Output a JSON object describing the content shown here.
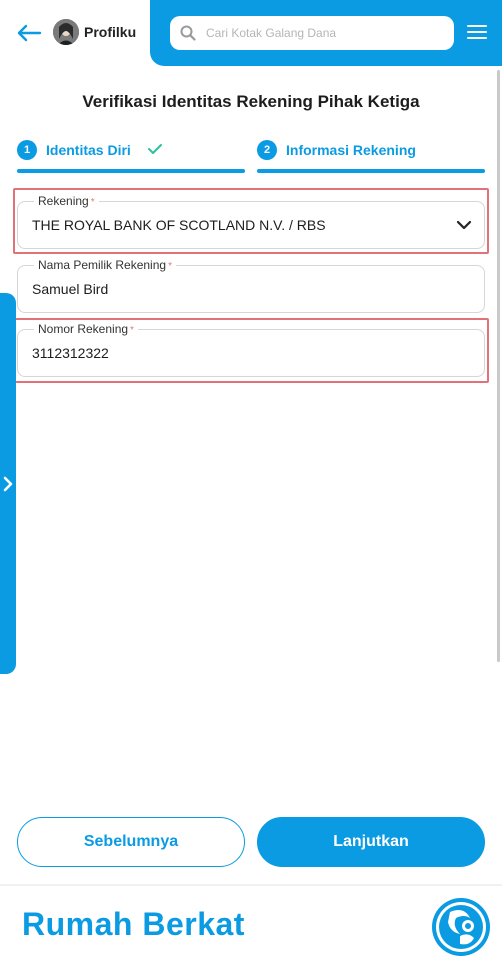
{
  "header": {
    "back_icon": "arrow-left-icon",
    "profile_label": "Profilku",
    "search_placeholder": "Cari Kotak Galang Dana",
    "menu_icon": "hamburger-menu-icon"
  },
  "page": {
    "title": "Verifikasi Identitas Rekening Pihak Ketiga"
  },
  "steps": [
    {
      "number": "1",
      "label": "Identitas Diri",
      "completed": true
    },
    {
      "number": "2",
      "label": "Informasi Rekening",
      "completed": false
    }
  ],
  "form": {
    "rekening": {
      "label": "Rekening",
      "required_mark": "*",
      "value": "THE ROYAL BANK OF SCOTLAND N.V. / RBS"
    },
    "nama_pemilik": {
      "label": "Nama Pemilik Rekening",
      "required_mark": "*",
      "value": "Samuel Bird"
    },
    "nomor_rekening": {
      "label": "Nomor Rekening",
      "required_mark": "*",
      "value": "3112312322"
    }
  },
  "buttons": {
    "prev_label": "Sebelumnya",
    "next_label": "Lanjutkan"
  },
  "footer": {
    "brand_name": "Rumah Berkat"
  },
  "colors": {
    "primary": "#0a9be3",
    "highlight": "#e0737a",
    "check": "#2cbfa0"
  }
}
